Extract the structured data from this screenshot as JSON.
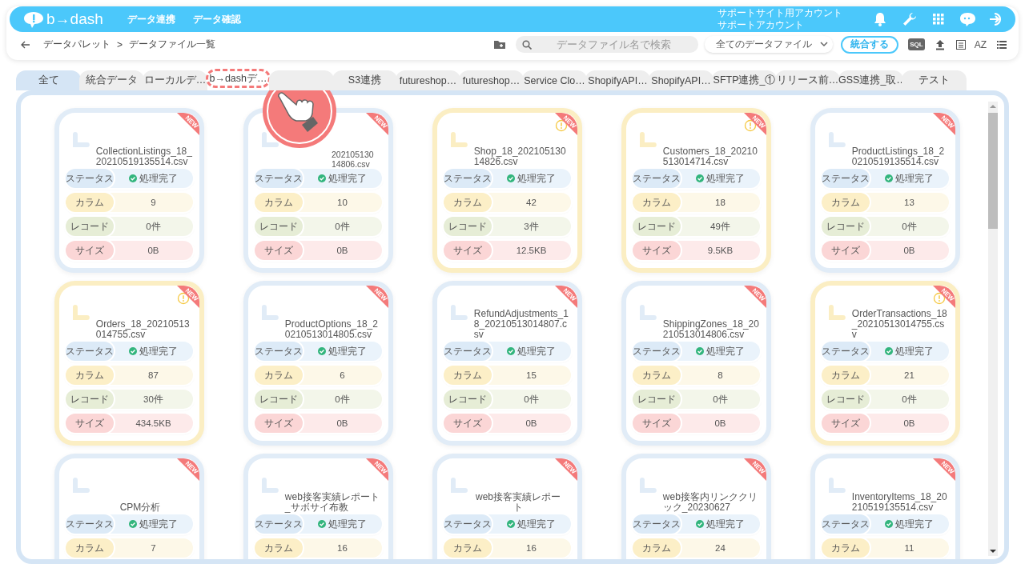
{
  "header": {
    "logo": "b→dash",
    "nav": [
      {
        "label": "データ連携"
      },
      {
        "label": "データ確認"
      }
    ],
    "account": [
      "サポートサイト用アカウント",
      "サポートアカウント"
    ]
  },
  "breadcrumb": {
    "items": [
      "データパレット",
      ">",
      "データファイル一覧"
    ]
  },
  "toolbar": {
    "search": {
      "placeholder": "データファイル名で検索"
    },
    "filter": {
      "value": "全てのデータファイル"
    },
    "merge_button": "統合する",
    "sql_label": "SQL",
    "sort_label": "AZ"
  },
  "tabs": [
    {
      "label": "全て",
      "selected": true,
      "highlighted": false
    },
    {
      "label": "統合データ",
      "selected": false,
      "highlighted": false
    },
    {
      "label": "ローカルデ…",
      "selected": false,
      "highlighted": false
    },
    {
      "label": "b→dashデ…",
      "selected": false,
      "highlighted": true
    },
    {
      "selected": false,
      "highlighted": false
    },
    {
      "label": "S3連携",
      "selected": false,
      "highlighted": false
    },
    {
      "label": "futureshop…",
      "selected": false,
      "highlighted": false
    },
    {
      "label": "futureshop…",
      "selected": false,
      "highlighted": false
    },
    {
      "label": "Service Clo…",
      "selected": false,
      "highlighted": false
    },
    {
      "label": "ShopifyAPI…",
      "selected": false,
      "highlighted": false
    },
    {
      "label": "ShopifyAPI…",
      "selected": false,
      "highlighted": false
    },
    {
      "label": "SFTP連携_①",
      "selected": false,
      "highlighted": false
    },
    {
      "label": "リリース前…",
      "selected": false,
      "highlighted": false
    },
    {
      "label": "GSS連携_取…",
      "selected": false,
      "highlighted": false
    },
    {
      "label": "テスト",
      "selected": false,
      "highlighted": false
    }
  ],
  "cards": [
    {
      "title": "CollectionListings_18_20210519135514.csv",
      "badge": "NEW",
      "warning": false,
      "fields": [
        {
          "kind": "status",
          "label": "ステータス",
          "value": "処理完了"
        },
        {
          "kind": "columns",
          "label": "カラム",
          "value": "9"
        },
        {
          "kind": "records",
          "label": "レコード",
          "value": "0件"
        },
        {
          "kind": "size",
          "label": "サイズ",
          "value": "0B"
        }
      ]
    },
    {
      "title": "20210513014806.csv",
      "badge": "NEW",
      "warning": false,
      "fields": [
        {
          "kind": "status",
          "label": "ステータス",
          "value": "処理完了"
        },
        {
          "kind": "columns",
          "label": "カラム",
          "value": "10"
        },
        {
          "kind": "records",
          "label": "レコード",
          "value": "0件"
        },
        {
          "kind": "size",
          "label": "サイズ",
          "value": "0B"
        }
      ]
    },
    {
      "title": "Shop_18_20210513014826.csv",
      "badge": "NEW",
      "warning": true,
      "fields": [
        {
          "kind": "status",
          "label": "ステータス",
          "value": "処理完了"
        },
        {
          "kind": "columns",
          "label": "カラム",
          "value": "42"
        },
        {
          "kind": "records",
          "label": "レコード",
          "value": "3件"
        },
        {
          "kind": "size",
          "label": "サイズ",
          "value": "12.5KB"
        }
      ]
    },
    {
      "title": "Customers_18_20210513014714.csv",
      "badge": "NEW",
      "warning": true,
      "fields": [
        {
          "kind": "status",
          "label": "ステータス",
          "value": "処理完了"
        },
        {
          "kind": "columns",
          "label": "カラム",
          "value": "18"
        },
        {
          "kind": "records",
          "label": "レコード",
          "value": "49件"
        },
        {
          "kind": "size",
          "label": "サイズ",
          "value": "9.5KB"
        }
      ]
    },
    {
      "title": "ProductListings_18_20210519135514.csv",
      "badge": "NEW",
      "warning": false,
      "fields": [
        {
          "kind": "status",
          "label": "ステータス",
          "value": "処理完了"
        },
        {
          "kind": "columns",
          "label": "カラム",
          "value": "13"
        },
        {
          "kind": "records",
          "label": "レコード",
          "value": "0件"
        },
        {
          "kind": "size",
          "label": "サイズ",
          "value": "0B"
        }
      ]
    },
    {
      "title": "Orders_18_20210513014755.csv",
      "badge": "NEW",
      "warning": true,
      "fields": [
        {
          "kind": "status",
          "label": "ステータス",
          "value": "処理完了"
        },
        {
          "kind": "columns",
          "label": "カラム",
          "value": "87"
        },
        {
          "kind": "records",
          "label": "レコード",
          "value": "30件"
        },
        {
          "kind": "size",
          "label": "サイズ",
          "value": "434.5KB"
        }
      ]
    },
    {
      "title": "ProductOptions_18_20210513014805.csv",
      "badge": "NEW",
      "warning": false,
      "fields": [
        {
          "kind": "status",
          "label": "ステータス",
          "value": "処理完了"
        },
        {
          "kind": "columns",
          "label": "カラム",
          "value": "6"
        },
        {
          "kind": "records",
          "label": "レコード",
          "value": "0件"
        },
        {
          "kind": "size",
          "label": "サイズ",
          "value": "0B"
        }
      ]
    },
    {
      "title": "RefundAdjustments_18_20210513014807.csv",
      "badge": "NEW",
      "warning": false,
      "fields": [
        {
          "kind": "status",
          "label": "ステータス",
          "value": "処理完了"
        },
        {
          "kind": "columns",
          "label": "カラム",
          "value": "15"
        },
        {
          "kind": "records",
          "label": "レコード",
          "value": "0件"
        },
        {
          "kind": "size",
          "label": "サイズ",
          "value": "0B"
        }
      ]
    },
    {
      "title": "ShippingZones_18_20210513014806.csv",
      "badge": "NEW",
      "warning": false,
      "fields": [
        {
          "kind": "status",
          "label": "ステータス",
          "value": "処理完了"
        },
        {
          "kind": "columns",
          "label": "カラム",
          "value": "8"
        },
        {
          "kind": "records",
          "label": "レコード",
          "value": "0件"
        },
        {
          "kind": "size",
          "label": "サイズ",
          "value": "0B"
        }
      ]
    },
    {
      "title": "OrderTransactions_18_20210513014755.csv",
      "badge": "NEW",
      "warning": true,
      "fields": [
        {
          "kind": "status",
          "label": "ステータス",
          "value": "処理完了"
        },
        {
          "kind": "columns",
          "label": "カラム",
          "value": "21"
        },
        {
          "kind": "records",
          "label": "レコード",
          "value": "0件"
        },
        {
          "kind": "size",
          "label": "サイズ",
          "value": "0B"
        }
      ]
    },
    {
      "title": "CPM分析",
      "badge": "NEW",
      "warning": false,
      "fields": [
        {
          "kind": "status",
          "label": "ステータス",
          "value": "処理完了"
        },
        {
          "kind": "columns",
          "label": "カラム",
          "value": "7"
        }
      ]
    },
    {
      "title": "web接客実績レポート_サボサイ布教",
      "badge": "NEW",
      "warning": false,
      "fields": [
        {
          "kind": "status",
          "label": "ステータス",
          "value": "処理完了"
        },
        {
          "kind": "columns",
          "label": "カラム",
          "value": "16"
        }
      ]
    },
    {
      "title": "web接客実績レポート",
      "badge": "NEW",
      "warning": false,
      "fields": [
        {
          "kind": "status",
          "label": "ステータス",
          "value": "処理完了"
        },
        {
          "kind": "columns",
          "label": "カラム",
          "value": "16"
        }
      ]
    },
    {
      "title": "web接客内リンククリック_20230627",
      "badge": "NEW",
      "warning": false,
      "fields": [
        {
          "kind": "status",
          "label": "ステータス",
          "value": "処理完了"
        },
        {
          "kind": "columns",
          "label": "カラム",
          "value": "24"
        }
      ]
    },
    {
      "title": "InventoryItems_18_20210519135514.csv",
      "badge": "NEW",
      "warning": false,
      "fields": [
        {
          "kind": "status",
          "label": "ステータス",
          "value": "処理完了"
        },
        {
          "kind": "columns",
          "label": "カラム",
          "value": "11"
        }
      ]
    }
  ]
}
